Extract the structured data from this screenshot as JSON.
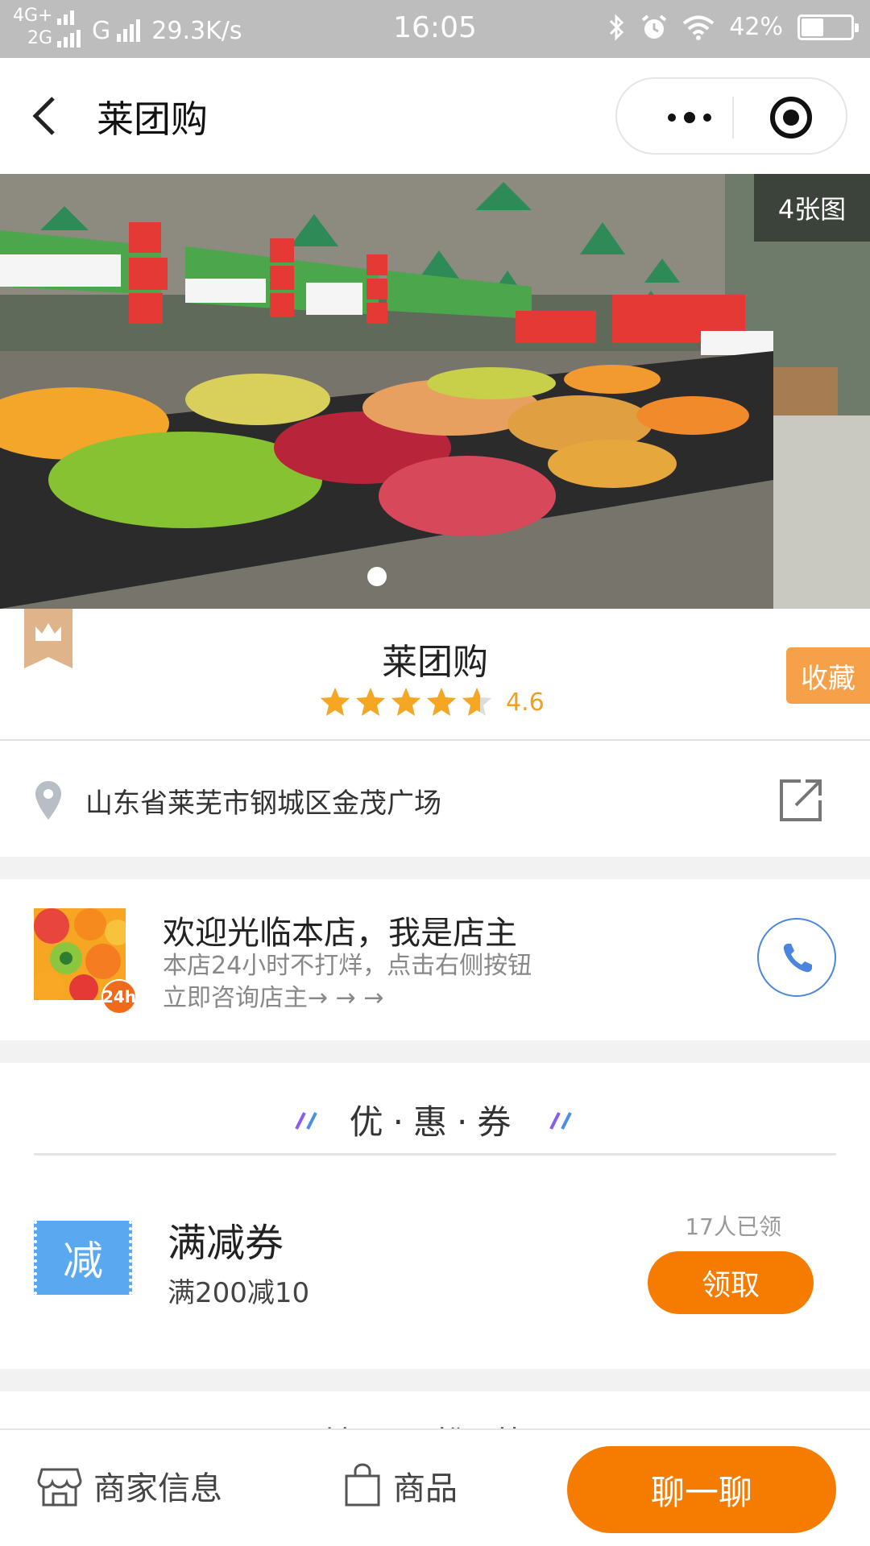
{
  "status_bar": {
    "net1": "4G+",
    "net2": "2G",
    "net3": "G",
    "speed": "29.3K/s",
    "time": "16:05",
    "battery": "42%",
    "battery_level": 0.42
  },
  "header": {
    "title": "莱团购"
  },
  "banner": {
    "image_count": "4张图",
    "icon": "supermarket-photo"
  },
  "store": {
    "name": "莱团购",
    "rating": "4.6",
    "rating_value": 4.6,
    "favorite_label": "收藏"
  },
  "address": {
    "text": "山东省莱芜市钢城区金茂广场"
  },
  "owner": {
    "title": "欢迎光临本店，我是店主",
    "desc_line1": "本店24小时不打烊，点击右侧按钮",
    "desc_line2": "立即咨询店主→ → →",
    "badge": "24h"
  },
  "coupons": {
    "section_title": "优·惠·券",
    "items": [
      {
        "icon_text": "减",
        "name": "满减券",
        "condition": "满200减10",
        "claimed": "17人已领",
        "button": "领取"
      }
    ]
  },
  "next_section": {
    "title_partial": "精品推荐"
  },
  "bottom_bar": {
    "info_label": "商家信息",
    "goods_label": "商品",
    "chat_label": "聊一聊"
  },
  "colors": {
    "orange": "#f57c00",
    "favorite_orange": "#f7a04a",
    "star": "#f5a623",
    "phone_blue": "#4a86e0",
    "coupon_blue": "#5aa8f0"
  }
}
